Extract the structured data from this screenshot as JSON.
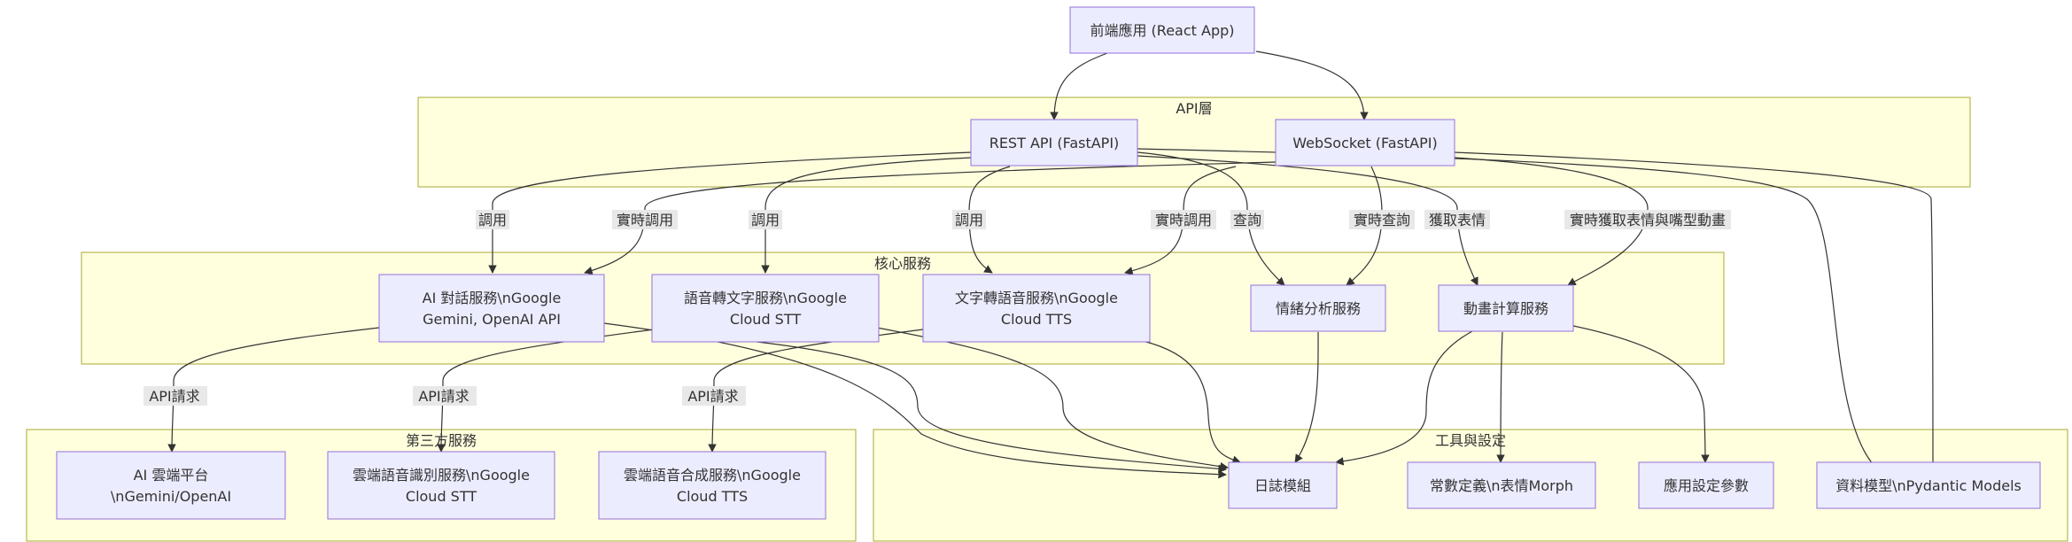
{
  "clusters": {
    "api": {
      "title": "API層"
    },
    "core": {
      "title": "核心服務"
    },
    "third": {
      "title": "第三方服務"
    },
    "tools": {
      "title": "工具與設定"
    }
  },
  "nodes": {
    "frontend": {
      "lines": [
        "前端應用 (React App)"
      ]
    },
    "rest": {
      "lines": [
        "REST API (FastAPI)"
      ]
    },
    "ws": {
      "lines": [
        "WebSocket (FastAPI)"
      ]
    },
    "ai": {
      "lines": [
        "AI 對話服務\\nGoogle",
        "Gemini, OpenAI API"
      ]
    },
    "stt": {
      "lines": [
        "語音轉文字服務\\nGoogle",
        "Cloud STT"
      ]
    },
    "tts": {
      "lines": [
        "文字轉語音服務\\nGoogle",
        "Cloud TTS"
      ]
    },
    "emotion": {
      "lines": [
        "情緒分析服務"
      ]
    },
    "anim": {
      "lines": [
        "動畫計算服務"
      ]
    },
    "aicloud": {
      "lines": [
        "AI 雲端平台",
        "\\nGemini/OpenAI"
      ]
    },
    "sttcloud": {
      "lines": [
        "雲端語音識別服務\\nGoogle",
        "Cloud STT"
      ]
    },
    "ttscloud": {
      "lines": [
        "雲端語音合成服務\\nGoogle",
        "Cloud TTS"
      ]
    },
    "log": {
      "lines": [
        "日誌模組"
      ]
    },
    "consts": {
      "lines": [
        "常數定義\\n表情Morph"
      ]
    },
    "config": {
      "lines": [
        "應用設定參數"
      ]
    },
    "models": {
      "lines": [
        "資料模型\\nPydantic Models"
      ]
    }
  },
  "edges": {
    "rest_ai": {
      "label": "調用"
    },
    "ws_ai": {
      "label": "實時調用"
    },
    "rest_stt": {
      "label": "調用"
    },
    "rest_tts": {
      "label": "調用"
    },
    "ws_tts": {
      "label": "實時調用"
    },
    "rest_emotion": {
      "label": "查詢"
    },
    "ws_emotion": {
      "label": "實時查詢"
    },
    "rest_anim": {
      "label": "獲取表情"
    },
    "ws_anim": {
      "label": "實時獲取表情與嘴型動畫"
    },
    "ai_cloud": {
      "label": "API請求"
    },
    "stt_cloud": {
      "label": "API請求"
    },
    "tts_cloud": {
      "label": "API請求"
    }
  }
}
